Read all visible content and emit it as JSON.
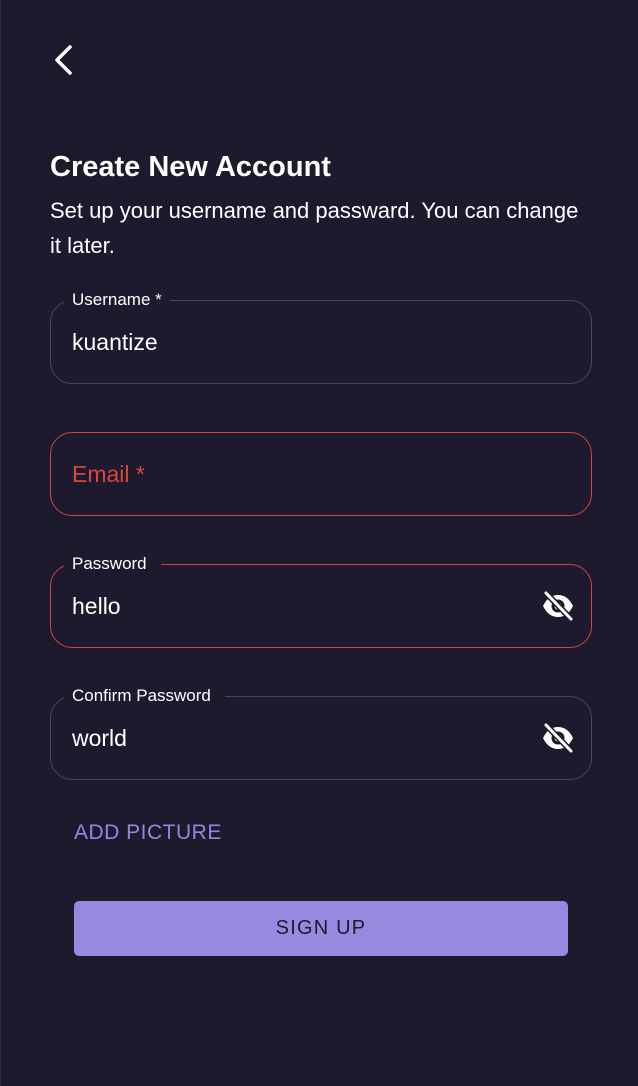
{
  "header": {
    "back_icon": "chevron-left-icon"
  },
  "intro": {
    "title": "Create New Account",
    "subtitle": "Set up your username and passward. You can change it later."
  },
  "form": {
    "username": {
      "label": "Username *",
      "value": "kuantize"
    },
    "email": {
      "placeholder": "Email *",
      "state": "error"
    },
    "password": {
      "label": "Password",
      "value": "hello",
      "toggle_icon": "eye-off-icon",
      "state": "error"
    },
    "confirm_password": {
      "label": "Confirm Password",
      "value": "world",
      "toggle_icon": "eye-off-icon"
    }
  },
  "actions": {
    "add_picture_label": "ADD PICTURE",
    "sign_up_label": "SIGN UP"
  },
  "colors": {
    "background": "#1d1a2e",
    "accent": "#958ae0",
    "error": "#d7473e",
    "border": "#4a4660"
  }
}
